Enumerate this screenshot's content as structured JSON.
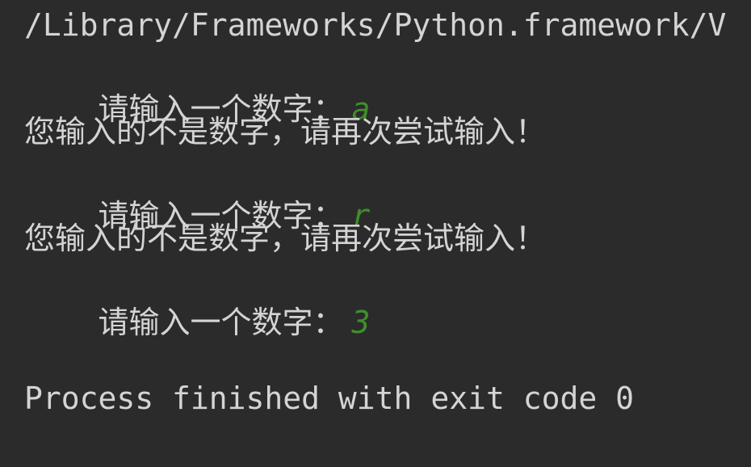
{
  "console": {
    "command_path": "/Library/Frameworks/Python.framework/V",
    "lines": [
      {
        "prompt": "请输入一个数字：",
        "input": "a"
      },
      {
        "message": "您输入的不是数字，请再次尝试输入！"
      },
      {
        "prompt": "请输入一个数字：",
        "input": "r"
      },
      {
        "message": "您输入的不是数字，请再次尝试输入！"
      },
      {
        "prompt": "请输入一个数字：",
        "input": "3"
      }
    ],
    "exit_message": "Process finished with exit code 0"
  },
  "colors": {
    "background": "#2b2b2b",
    "text": "#d4d4d4",
    "user_input": "#3f8f2a"
  }
}
